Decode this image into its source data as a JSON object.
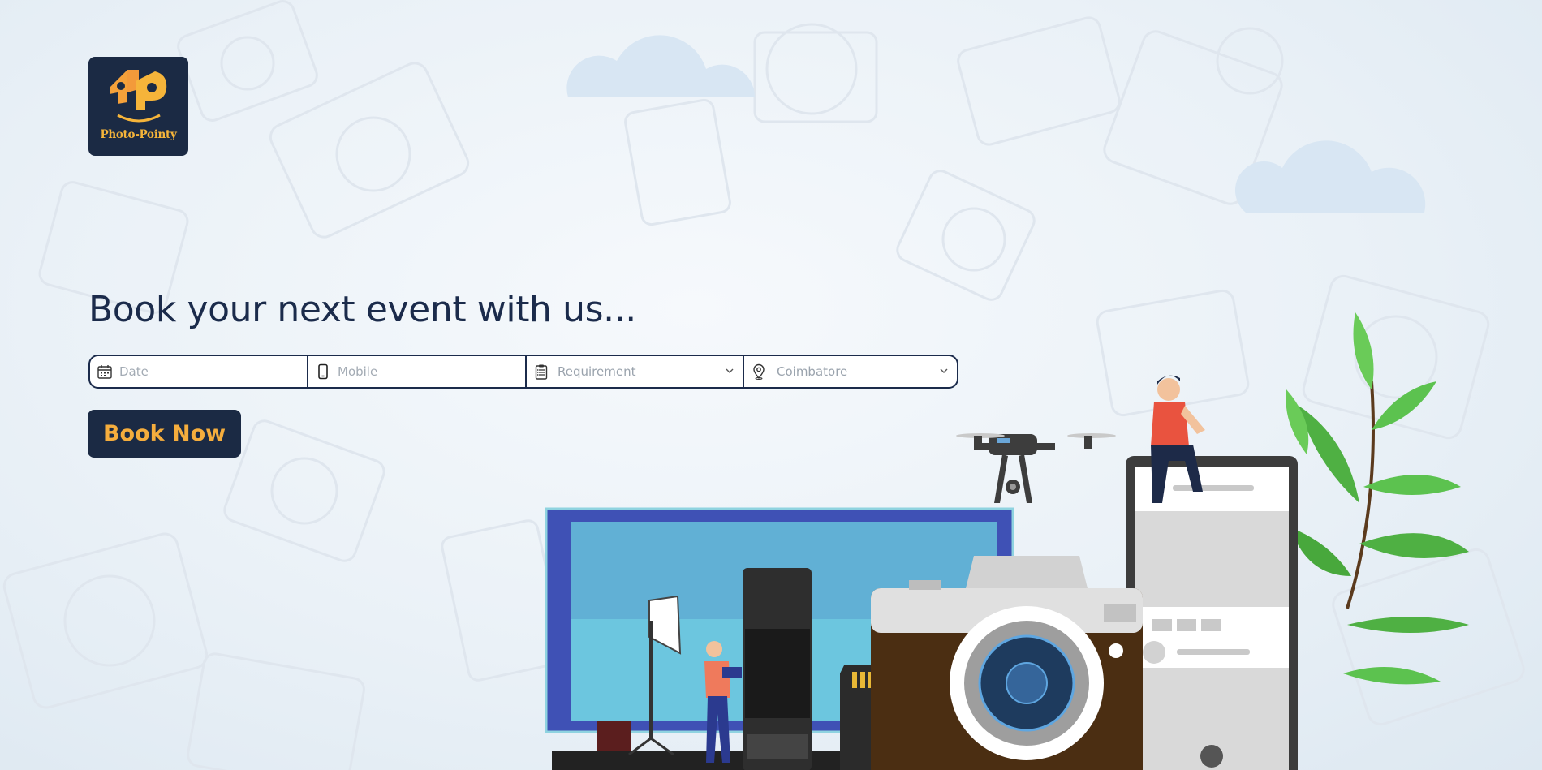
{
  "brand": {
    "logo_text": "Photo-Pointy",
    "colors": {
      "navy": "#1b2a44",
      "accent": "#f5ad3d"
    }
  },
  "hero": {
    "headline": "Book your next event with us..."
  },
  "form": {
    "date": {
      "placeholder": "Date",
      "icon": "calendar-icon"
    },
    "mobile": {
      "placeholder": "Mobile",
      "icon": "phone-icon"
    },
    "requirement": {
      "selected": "Requirement",
      "icon": "clipboard-icon"
    },
    "location": {
      "selected": "Coimbatore",
      "icon": "location-pin-icon"
    }
  },
  "cta": {
    "label": "Book Now"
  }
}
